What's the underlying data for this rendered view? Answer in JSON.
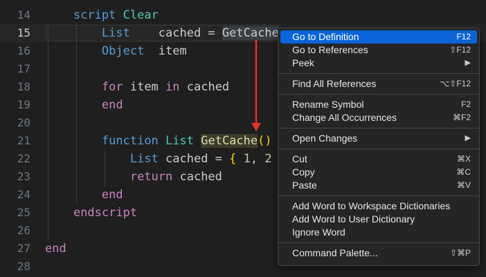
{
  "editor": {
    "lines": [
      {
        "n": "14",
        "tokens": [
          {
            "t": "    ",
            "c": "id"
          },
          {
            "t": "script",
            "c": "kb"
          },
          {
            "t": " ",
            "c": "id"
          },
          {
            "t": "Clear",
            "c": "ty"
          }
        ]
      },
      {
        "n": "15",
        "tokens": [
          {
            "t": "        ",
            "c": "id"
          },
          {
            "t": "List",
            "c": "kb"
          },
          {
            "t": "    cached = ",
            "c": "id"
          },
          {
            "t": "GetCache",
            "c": "hl"
          }
        ]
      },
      {
        "n": "16",
        "tokens": [
          {
            "t": "        ",
            "c": "id"
          },
          {
            "t": "Object",
            "c": "kb"
          },
          {
            "t": "  item",
            "c": "id"
          }
        ]
      },
      {
        "n": "17",
        "tokens": []
      },
      {
        "n": "18",
        "tokens": [
          {
            "t": "        ",
            "c": "id"
          },
          {
            "t": "for",
            "c": "kw"
          },
          {
            "t": " item ",
            "c": "id"
          },
          {
            "t": "in",
            "c": "kw"
          },
          {
            "t": " cached",
            "c": "id"
          }
        ]
      },
      {
        "n": "19",
        "tokens": [
          {
            "t": "        ",
            "c": "id"
          },
          {
            "t": "end",
            "c": "kw"
          }
        ]
      },
      {
        "n": "20",
        "tokens": []
      },
      {
        "n": "21",
        "tokens": [
          {
            "t": "        ",
            "c": "id"
          },
          {
            "t": "function",
            "c": "kb"
          },
          {
            "t": " ",
            "c": "id"
          },
          {
            "t": "List",
            "c": "ty"
          },
          {
            "t": " ",
            "c": "id"
          },
          {
            "t": "GetCache",
            "c": "hl2"
          },
          {
            "t": "()",
            "c": "br"
          }
        ]
      },
      {
        "n": "22",
        "tokens": [
          {
            "t": "            ",
            "c": "id"
          },
          {
            "t": "List",
            "c": "kb"
          },
          {
            "t": " cached = ",
            "c": "id"
          },
          {
            "t": "{",
            "c": "br"
          },
          {
            "t": " ",
            "c": "id"
          },
          {
            "t": "1",
            "c": "num"
          },
          {
            "t": ", ",
            "c": "id"
          },
          {
            "t": "2",
            "c": "num"
          }
        ]
      },
      {
        "n": "23",
        "tokens": [
          {
            "t": "            ",
            "c": "id"
          },
          {
            "t": "return",
            "c": "kw"
          },
          {
            "t": " cached",
            "c": "id"
          }
        ]
      },
      {
        "n": "24",
        "tokens": [
          {
            "t": "        ",
            "c": "id"
          },
          {
            "t": "end",
            "c": "kw"
          }
        ]
      },
      {
        "n": "25",
        "tokens": [
          {
            "t": "    ",
            "c": "id"
          },
          {
            "t": "endscript",
            "c": "kw"
          }
        ]
      },
      {
        "n": "26",
        "tokens": []
      },
      {
        "n": "27",
        "tokens": [
          {
            "t": "end",
            "c": "kw"
          }
        ]
      },
      {
        "n": "28",
        "tokens": []
      }
    ],
    "active_line": "15"
  },
  "context_menu": {
    "groups": [
      [
        {
          "label": "Go to Definition",
          "shortcut": "F12",
          "selected": true
        },
        {
          "label": "Go to References",
          "shortcut": "⇧F12"
        },
        {
          "label": "Peek",
          "shortcut": "▶"
        }
      ],
      [
        {
          "label": "Find All References",
          "shortcut": "⌥⇧F12"
        }
      ],
      [
        {
          "label": "Rename Symbol",
          "shortcut": "F2"
        },
        {
          "label": "Change All Occurrences",
          "shortcut": "⌘F2"
        }
      ],
      [
        {
          "label": "Open Changes",
          "shortcut": "▶"
        }
      ],
      [
        {
          "label": "Cut",
          "shortcut": "⌘X"
        },
        {
          "label": "Copy",
          "shortcut": "⌘C"
        },
        {
          "label": "Paste",
          "shortcut": "⌘V"
        }
      ],
      [
        {
          "label": "Add Word to Workspace Dictionaries",
          "shortcut": ""
        },
        {
          "label": "Add Word to User Dictionary",
          "shortcut": ""
        },
        {
          "label": "Ignore Word",
          "shortcut": ""
        }
      ],
      [
        {
          "label": "Command Palette...",
          "shortcut": "⇧⌘P"
        }
      ]
    ]
  },
  "annotation": {
    "arrow_color": "#e5332a"
  }
}
